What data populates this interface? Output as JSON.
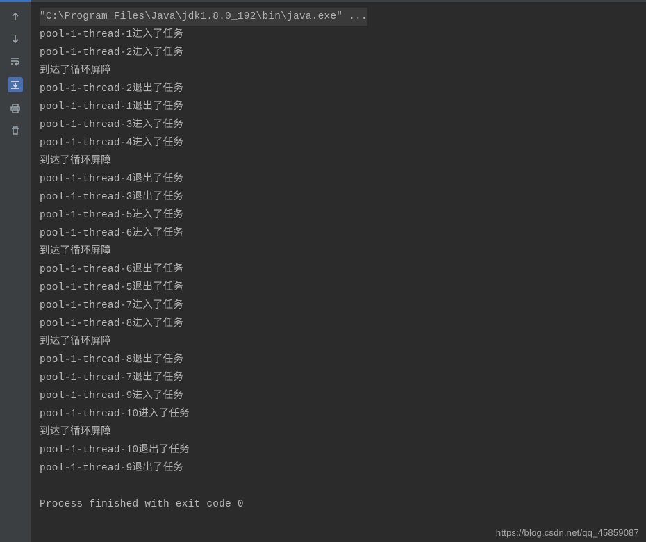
{
  "command_line": "\"C:\\Program Files\\Java\\jdk1.8.0_192\\bin\\java.exe\" ...",
  "lines": [
    "pool-1-thread-1进入了任务",
    "pool-1-thread-2进入了任务",
    "到达了循环屏障",
    "pool-1-thread-2退出了任务",
    "pool-1-thread-1退出了任务",
    "pool-1-thread-3进入了任务",
    "pool-1-thread-4进入了任务",
    "到达了循环屏障",
    "pool-1-thread-4退出了任务",
    "pool-1-thread-3退出了任务",
    "pool-1-thread-5进入了任务",
    "pool-1-thread-6进入了任务",
    "到达了循环屏障",
    "pool-1-thread-6退出了任务",
    "pool-1-thread-5退出了任务",
    "pool-1-thread-7进入了任务",
    "pool-1-thread-8进入了任务",
    "到达了循环屏障",
    "pool-1-thread-8退出了任务",
    "pool-1-thread-7退出了任务",
    "pool-1-thread-9进入了任务",
    "pool-1-thread-10进入了任务",
    "到达了循环屏障",
    "pool-1-thread-10退出了任务",
    "pool-1-thread-9退出了任务"
  ],
  "exit_line": "Process finished with exit code 0",
  "gutter": {
    "up": "arrow-up",
    "down": "arrow-down",
    "wrap": "soft-wrap",
    "scroll_end": "scroll-to-end",
    "print": "print",
    "clear": "clear-all"
  },
  "watermark": "https://blog.csdn.net/qq_45859087",
  "colors": {
    "bg": "#2b2b2b",
    "gutter": "#3c3f41",
    "text": "#b7b7b7",
    "accent": "#4b6eaf"
  }
}
